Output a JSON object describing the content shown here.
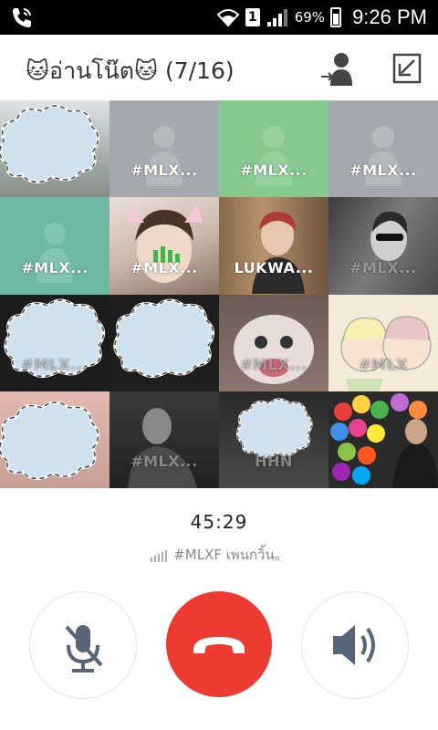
{
  "status": {
    "battery": "69%",
    "sim": "1",
    "time": "9:26 PM"
  },
  "header": {
    "title": "🐱อ่านโน๊ต🐱 (7/16)",
    "icons": [
      "add-member-icon",
      "minimize-icon"
    ]
  },
  "tiles": [
    "",
    "#MLX...",
    "#MLX...",
    "#MLX...",
    "#MLX...",
    "#MLX...",
    "LUKWA...",
    "#MLX...",
    "#MLX...",
    "",
    "#MLX...",
    "#MLX",
    "",
    "#MLX...",
    "HHN",
    ""
  ],
  "call": {
    "timer": "45:29",
    "name": "#MLXF เพนกวิ้น。"
  },
  "controls": {
    "mute": "microphone-muted-icon",
    "end": "end-call-icon",
    "speaker": "speaker-icon"
  },
  "colors": {
    "end_call": "#ee3b31",
    "tile_gray": "#a6aab0",
    "tile_green": "#86c98f"
  }
}
